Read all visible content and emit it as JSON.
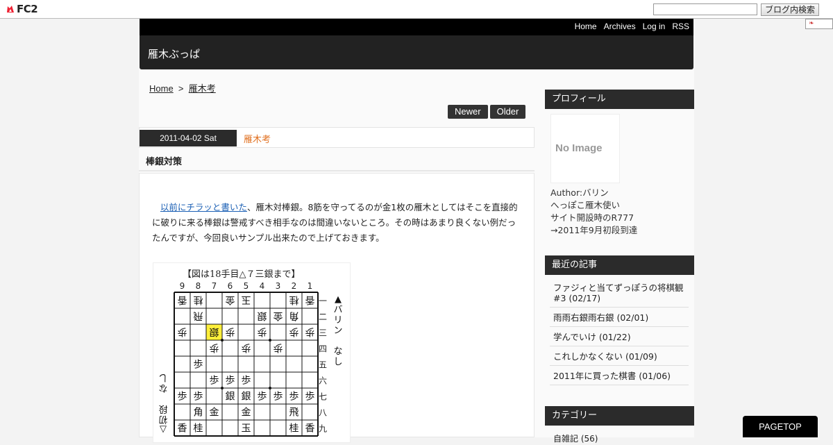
{
  "fc2": {
    "logo_text": "FC2",
    "search_button": "ブログ内検索",
    "search_value": ""
  },
  "nav": {
    "home": "Home",
    "archives": "Archives",
    "login": "Log in",
    "rss": "RSS"
  },
  "blog": {
    "title": "雁木ぶっぱ"
  },
  "breadcrumb": {
    "home": "Home",
    "sep": ">",
    "category": "雁木考"
  },
  "pager": {
    "newer": "Newer",
    "older": "Older"
  },
  "entry": {
    "date": "2011-04-02 Sat",
    "category": "雁木考",
    "title": "棒銀対策",
    "link_text": "以前にチラッと書いた",
    "body_rest": "、雁木対棒銀。8筋を守ってるのが金1枚の雁木としてはそこを直接的に破りに来る棒銀は警戒すべき相手なのは間違いないところ。その時はあまり良くない例だったんですが、今回良いサンプル出来たので上げておきます。"
  },
  "diagram": {
    "caption": "【図は18手目△７三銀まで】",
    "col_labels": [
      "9",
      "8",
      "7",
      "6",
      "5",
      "4",
      "3",
      "2",
      "1"
    ],
    "row_labels": [
      "一",
      "二",
      "三",
      "四",
      "五",
      "六",
      "七",
      "八",
      "九"
    ],
    "sente_side": "▲バリン なし",
    "gote_side": "△初段 なし",
    "highlight_color": "#ffef3a",
    "board": [
      [
        "香",
        "桂",
        "",
        "金",
        "玉",
        "",
        "",
        "桂",
        "香"
      ],
      [
        "",
        "飛",
        "",
        "",
        "",
        "銀",
        "金",
        "角",
        ""
      ],
      [
        "歩",
        "",
        "銀",
        "歩",
        "",
        "歩",
        "",
        "歩",
        "歩"
      ],
      [
        "",
        "",
        "歩",
        "",
        "歩",
        "",
        "歩",
        "",
        ""
      ],
      [
        "",
        "歩",
        "",
        "",
        "",
        "",
        "",
        "",
        ""
      ],
      [
        "",
        "",
        "歩",
        "歩",
        "歩",
        "",
        "",
        "",
        ""
      ],
      [
        "歩",
        "歩",
        "",
        "銀",
        "銀",
        "歩",
        "歩",
        "歩",
        "歩"
      ],
      [
        "",
        "角",
        "金",
        "",
        "金",
        "",
        "",
        "飛",
        ""
      ],
      [
        "香",
        "桂",
        "",
        "",
        "玉",
        "",
        "",
        "桂",
        "香"
      ]
    ],
    "gote_rows": [
      0,
      1,
      2,
      3,
      4
    ],
    "highlight": [
      2,
      2
    ]
  },
  "sidebar": {
    "profile_head": "プロフィール",
    "no_image": "No Image",
    "profile_lines": [
      "Author:バリン",
      "へっぽこ雁木使い",
      "サイト開設時のR777",
      "→2011年9月初段到達"
    ],
    "recent_head": "最近の記事",
    "recent_items": [
      "ファジィと当てずっぽうの将棋観 #3 (02/17)",
      "雨雨右銀雨右銀 (02/01)",
      "学んでいけ (01/22)",
      "これしかなくない (01/09)",
      "2011年に買った棋書 (01/06)"
    ],
    "category_head": "カテゴリー",
    "category_first": "自雑記 (56)"
  },
  "pagetop": "PAGETOP"
}
